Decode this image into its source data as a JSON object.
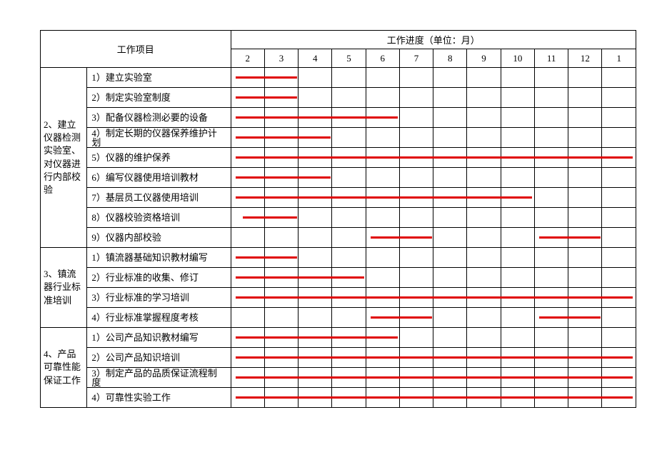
{
  "header": {
    "project_col": "工作项目",
    "progress_title": "工作进度（单位：月）",
    "months": [
      "2",
      "3",
      "4",
      "5",
      "6",
      "7",
      "8",
      "9",
      "10",
      "11",
      "12",
      "1"
    ]
  },
  "sections": [
    {
      "name": "2、建立仪器检测实验室、对仪器进行内部校验",
      "tasks": [
        {
          "label": "1）建立实验室",
          "start": 1,
          "end": 2
        },
        {
          "label": "2）制定实验室制度",
          "start": 1,
          "end": 2
        },
        {
          "label": "3）配备仪器检测必要的设备",
          "start": 1,
          "end": 5
        },
        {
          "label": "4）制定长期的仪器保养维护计划",
          "start": 1,
          "end": 3
        },
        {
          "label": "5）仪器的维护保养",
          "start": 1,
          "end": 12
        },
        {
          "label": "6）编写仪器使用培训教材",
          "start": 1,
          "end": 3
        },
        {
          "label": "7）基层员工仪器使用培训",
          "start": 1,
          "end": 9
        },
        {
          "label": "8）仪器校验资格培训",
          "start": 1,
          "end": 2,
          "short": true
        },
        {
          "label": "9）仪器内部校验",
          "segments": [
            {
              "start": 5,
              "end": 6
            },
            {
              "start": 10,
              "end": 11
            }
          ]
        }
      ]
    },
    {
      "name": "3、镇流器行业标准培训",
      "tasks": [
        {
          "label": "1）镇流器基础知识教材编写",
          "start": 1,
          "end": 2
        },
        {
          "label": "2）行业标准的收集、修订",
          "start": 1,
          "end": 4
        },
        {
          "label": "3）行业标准的学习培训",
          "start": 1,
          "end": 12
        },
        {
          "label": "4）行业标准掌握程度考核",
          "segments": [
            {
              "start": 5,
              "end": 6
            },
            {
              "start": 10,
              "end": 11
            }
          ]
        }
      ]
    },
    {
      "name": "4、产品可靠性能保证工作",
      "tasks": [
        {
          "label": "1）公司产品知识教材编写",
          "start": 1,
          "end": 5
        },
        {
          "label": "2）公司产品知识培训",
          "start": 1,
          "end": 12
        },
        {
          "label": "3）制定产品的品质保证流程制度",
          "start": 1,
          "end": 12
        },
        {
          "label": "4）可靠性实验工作",
          "start": 1,
          "end": 12
        }
      ]
    }
  ],
  "chart_data": {
    "type": "bar",
    "title": "工作进度（单位：月）",
    "xlabel": "月",
    "ylabel": "工作项目",
    "x": [
      2,
      3,
      4,
      5,
      6,
      7,
      8,
      9,
      10,
      11,
      12,
      1
    ],
    "categories": [
      "建立实验室",
      "制定实验室制度",
      "配备仪器检测必要的设备",
      "制定长期的仪器保养维护计划",
      "仪器的维护保养",
      "编写仪器使用培训教材",
      "基层员工仪器使用培训",
      "仪器校验资格培训",
      "仪器内部校验",
      "镇流器基础知识教材编写",
      "行业标准的收集、修订",
      "行业标准的学习培训",
      "行业标准掌握程度考核",
      "公司产品知识教材编写",
      "公司产品知识培训",
      "制定产品的品质保证流程制度",
      "可靠性实验工作"
    ],
    "series": [
      {
        "name": "建立实验室",
        "start": 3,
        "end": 3
      },
      {
        "name": "制定实验室制度",
        "start": 3,
        "end": 3
      },
      {
        "name": "配备仪器检测必要的设备",
        "start": 3,
        "end": 6
      },
      {
        "name": "制定长期的仪器保养维护计划",
        "start": 3,
        "end": 4
      },
      {
        "name": "仪器的维护保养",
        "start": 3,
        "end": 1
      },
      {
        "name": "编写仪器使用培训教材",
        "start": 3,
        "end": 4
      },
      {
        "name": "基层员工仪器使用培训",
        "start": 3,
        "end": 10
      },
      {
        "name": "仪器校验资格培训",
        "start": 3,
        "end": 3
      },
      {
        "name": "仪器内部校验",
        "segments": [
          [
            7,
            7
          ],
          [
            12,
            12
          ]
        ]
      },
      {
        "name": "镇流器基础知识教材编写",
        "start": 3,
        "end": 3
      },
      {
        "name": "行业标准的收集、修订",
        "start": 3,
        "end": 5
      },
      {
        "name": "行业标准的学习培训",
        "start": 3,
        "end": 1
      },
      {
        "name": "行业标准掌握程度考核",
        "segments": [
          [
            7,
            7
          ],
          [
            12,
            12
          ]
        ]
      },
      {
        "name": "公司产品知识教材编写",
        "start": 3,
        "end": 6
      },
      {
        "name": "公司产品知识培训",
        "start": 3,
        "end": 1
      },
      {
        "name": "制定产品的品质保证流程制度",
        "start": 3,
        "end": 1
      },
      {
        "name": "可靠性实验工作",
        "start": 3,
        "end": 1
      }
    ]
  }
}
